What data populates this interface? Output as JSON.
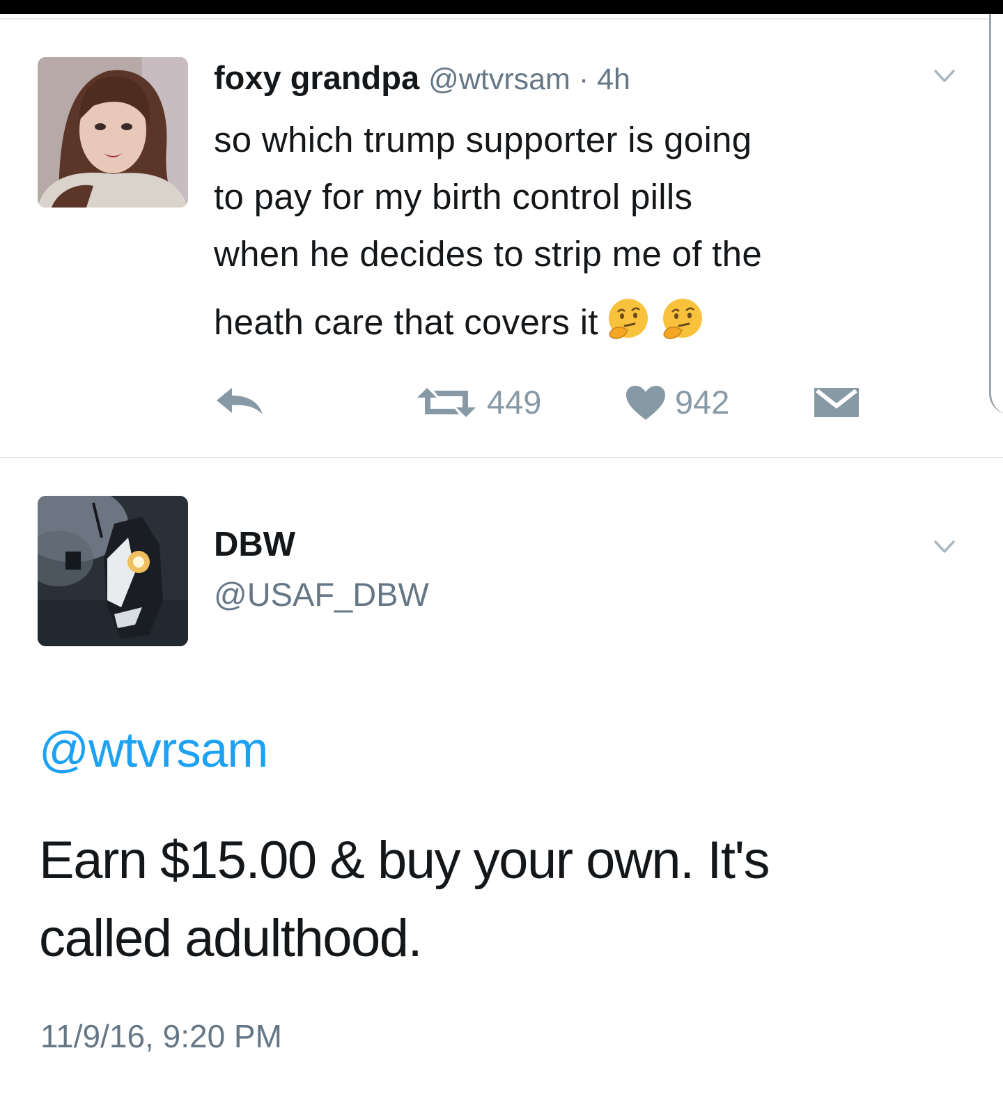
{
  "tweet1": {
    "name": "foxy grandpa",
    "handle": "@wtvrsam",
    "separator": "·",
    "time": "4h",
    "text_lines": [
      "so which trump supporter is going",
      "to pay for my birth control pills",
      "when he decides to strip me of the",
      "heath care that covers it"
    ],
    "emojis": [
      "thinking-face",
      "thinking-face"
    ],
    "retweet_count": "449",
    "like_count": "942"
  },
  "tweet2": {
    "name": "DBW",
    "handle": "@USAF_DBW",
    "mention": "@wtvrsam",
    "text_lines": [
      "Earn $15.00 & buy your own. It's",
      "called adulthood."
    ],
    "timestamp": "11/9/16, 9:20 PM"
  },
  "icons": {
    "reply": "reply-icon",
    "retweet": "retweet-icon",
    "like": "heart-icon",
    "dm": "envelope-icon",
    "more": "chevron-down-icon"
  },
  "colors": {
    "text": "#14171a",
    "secondary": "#657786",
    "action_gray": "#8899a6",
    "link_blue": "#1da1f2",
    "divider": "#e1e8ed"
  }
}
